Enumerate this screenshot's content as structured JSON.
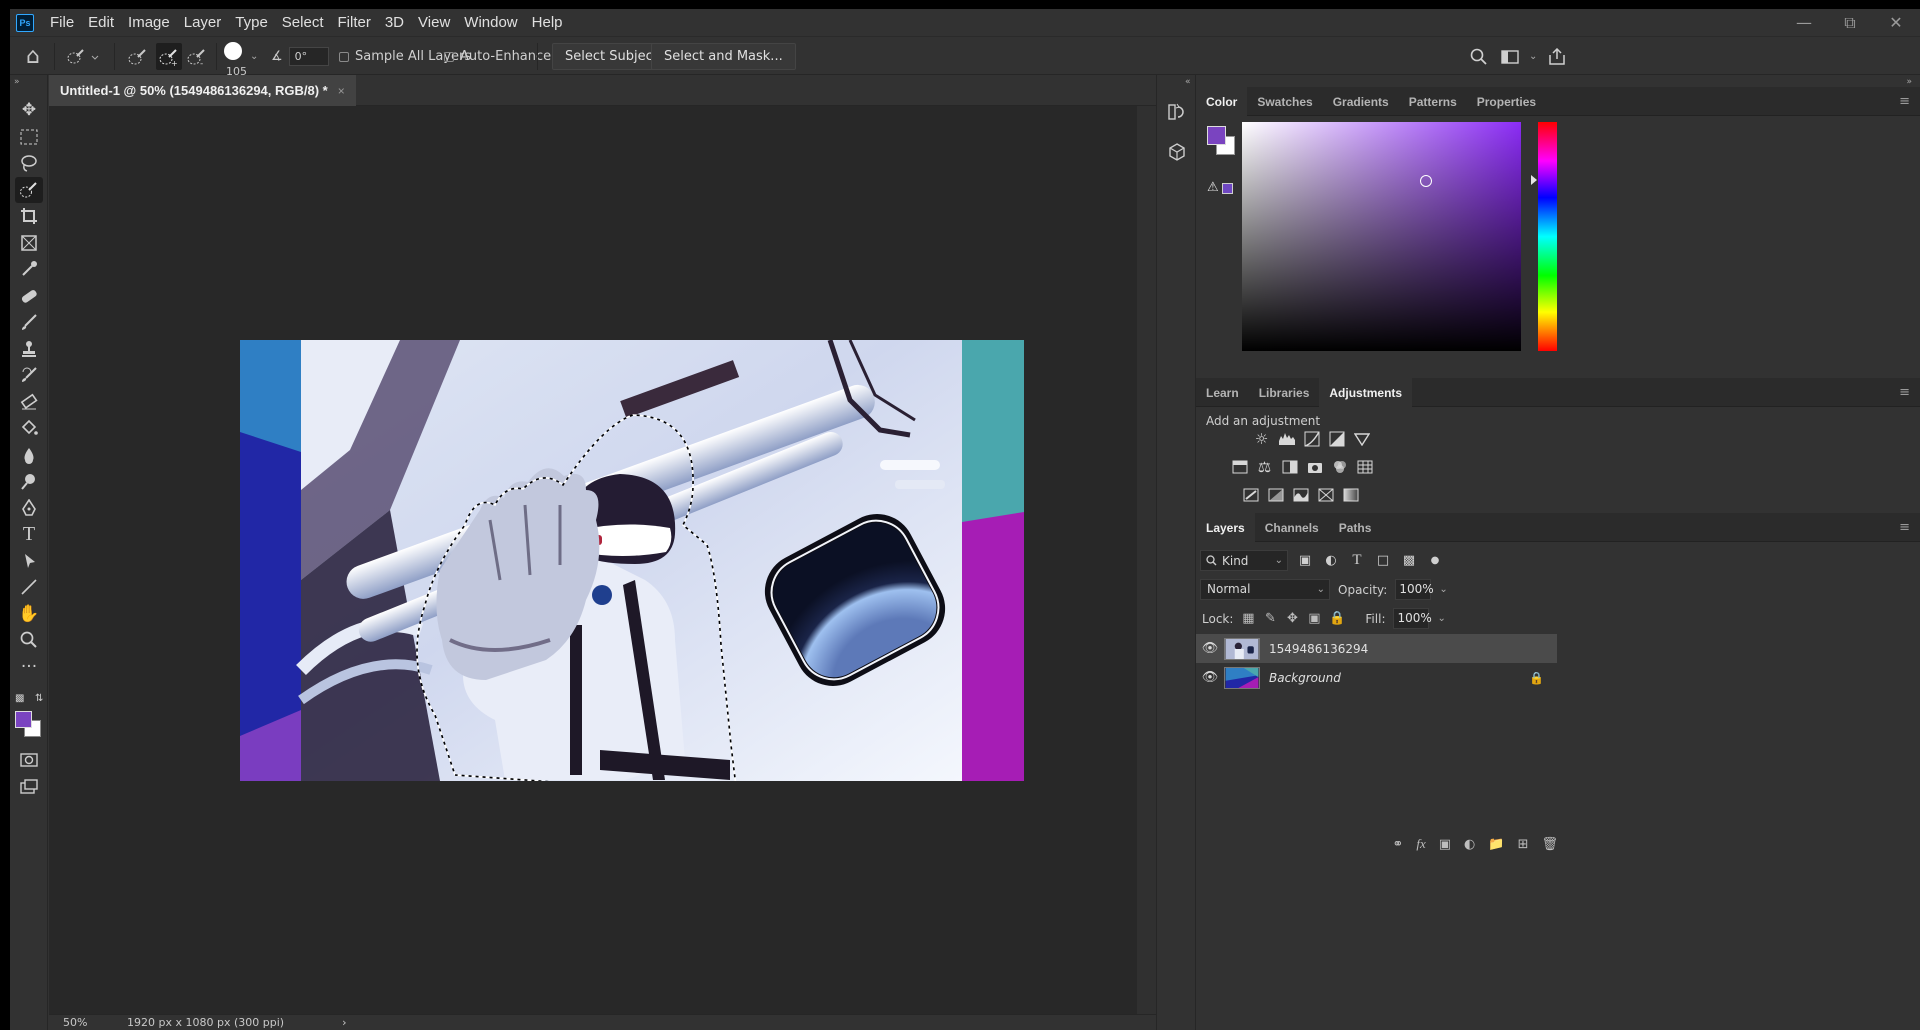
{
  "app": {
    "logo": "Ps"
  },
  "menu": [
    "File",
    "Edit",
    "Image",
    "Layer",
    "Type",
    "Select",
    "Filter",
    "3D",
    "View",
    "Window",
    "Help"
  ],
  "window_controls": {
    "minimize": "—",
    "restore": "⧉",
    "close": "✕"
  },
  "options": {
    "brush_size": "105",
    "angle": "0°",
    "sample_all_layers": "Sample All Layers",
    "auto_enhance": "Auto-Enhance",
    "select_subject": "Select Subject",
    "select_and_mask": "Select and Mask..."
  },
  "document": {
    "tab_title": "Untitled-1 @ 50% (1549486136294, RGB/8) *",
    "close": "×",
    "zoom": "50%",
    "info": "1920 px x 1080 px (300 ppi)",
    "info_arrow": "›"
  },
  "color_panel": {
    "tabs": [
      "Color",
      "Swatches",
      "Gradients",
      "Patterns",
      "Properties"
    ],
    "foreground": "#7a44c0",
    "background": "#ffffff"
  },
  "adjust_panel": {
    "tabs": [
      "Learn",
      "Libraries",
      "Adjustments"
    ],
    "label": "Add an adjustment"
  },
  "layers_panel": {
    "tabs": [
      "Layers",
      "Channels",
      "Paths"
    ],
    "kind": "Kind",
    "blend_mode": "Normal",
    "opacity_label": "Opacity:",
    "opacity": "100%",
    "lock_label": "Lock:",
    "fill_label": "Fill:",
    "fill": "100%",
    "layers": [
      {
        "name": "1549486136294",
        "selected": true
      },
      {
        "name": "Background",
        "selected": false,
        "locked": true
      }
    ]
  },
  "icons": {
    "home": "⌂",
    "collapse_left": "«",
    "collapse_right": "»",
    "panel_menu": "≡"
  }
}
